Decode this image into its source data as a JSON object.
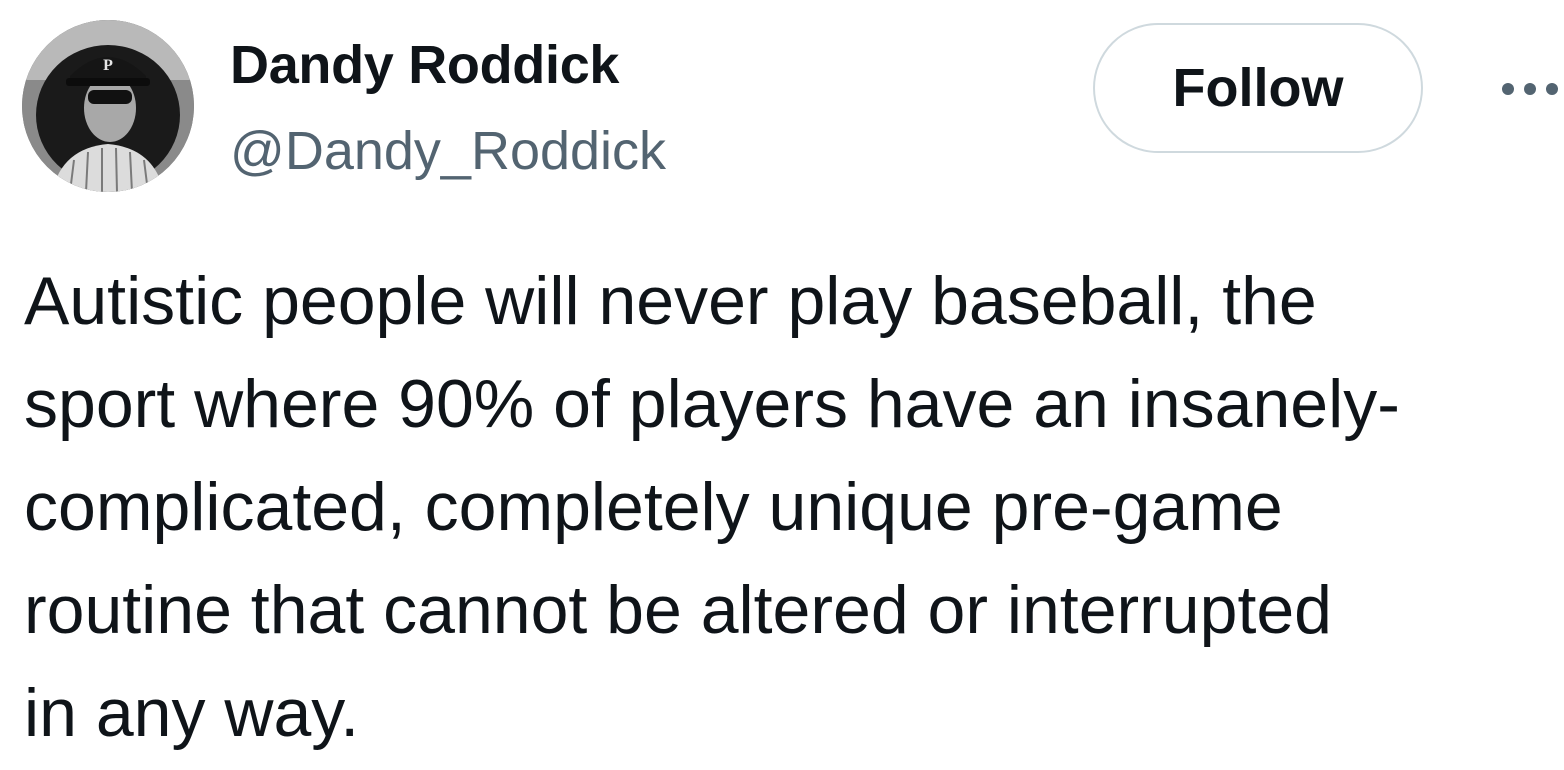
{
  "author": {
    "display_name": "Dandy Roddick",
    "handle": "@Dandy_Roddick",
    "avatar_icon": "profile-photo"
  },
  "actions": {
    "follow_label": "Follow",
    "more_icon": "more-options-icon"
  },
  "tweet": {
    "lines": [
      "Autistic people will never play baseball, the",
      "sport where 90% of players have an insanely-",
      "complicated, completely unique pre-game",
      "routine that cannot be altered or interrupted",
      "in any way."
    ]
  },
  "colors": {
    "text_primary": "#0f1419",
    "text_secondary": "#536471",
    "button_border": "#cfd9de"
  }
}
